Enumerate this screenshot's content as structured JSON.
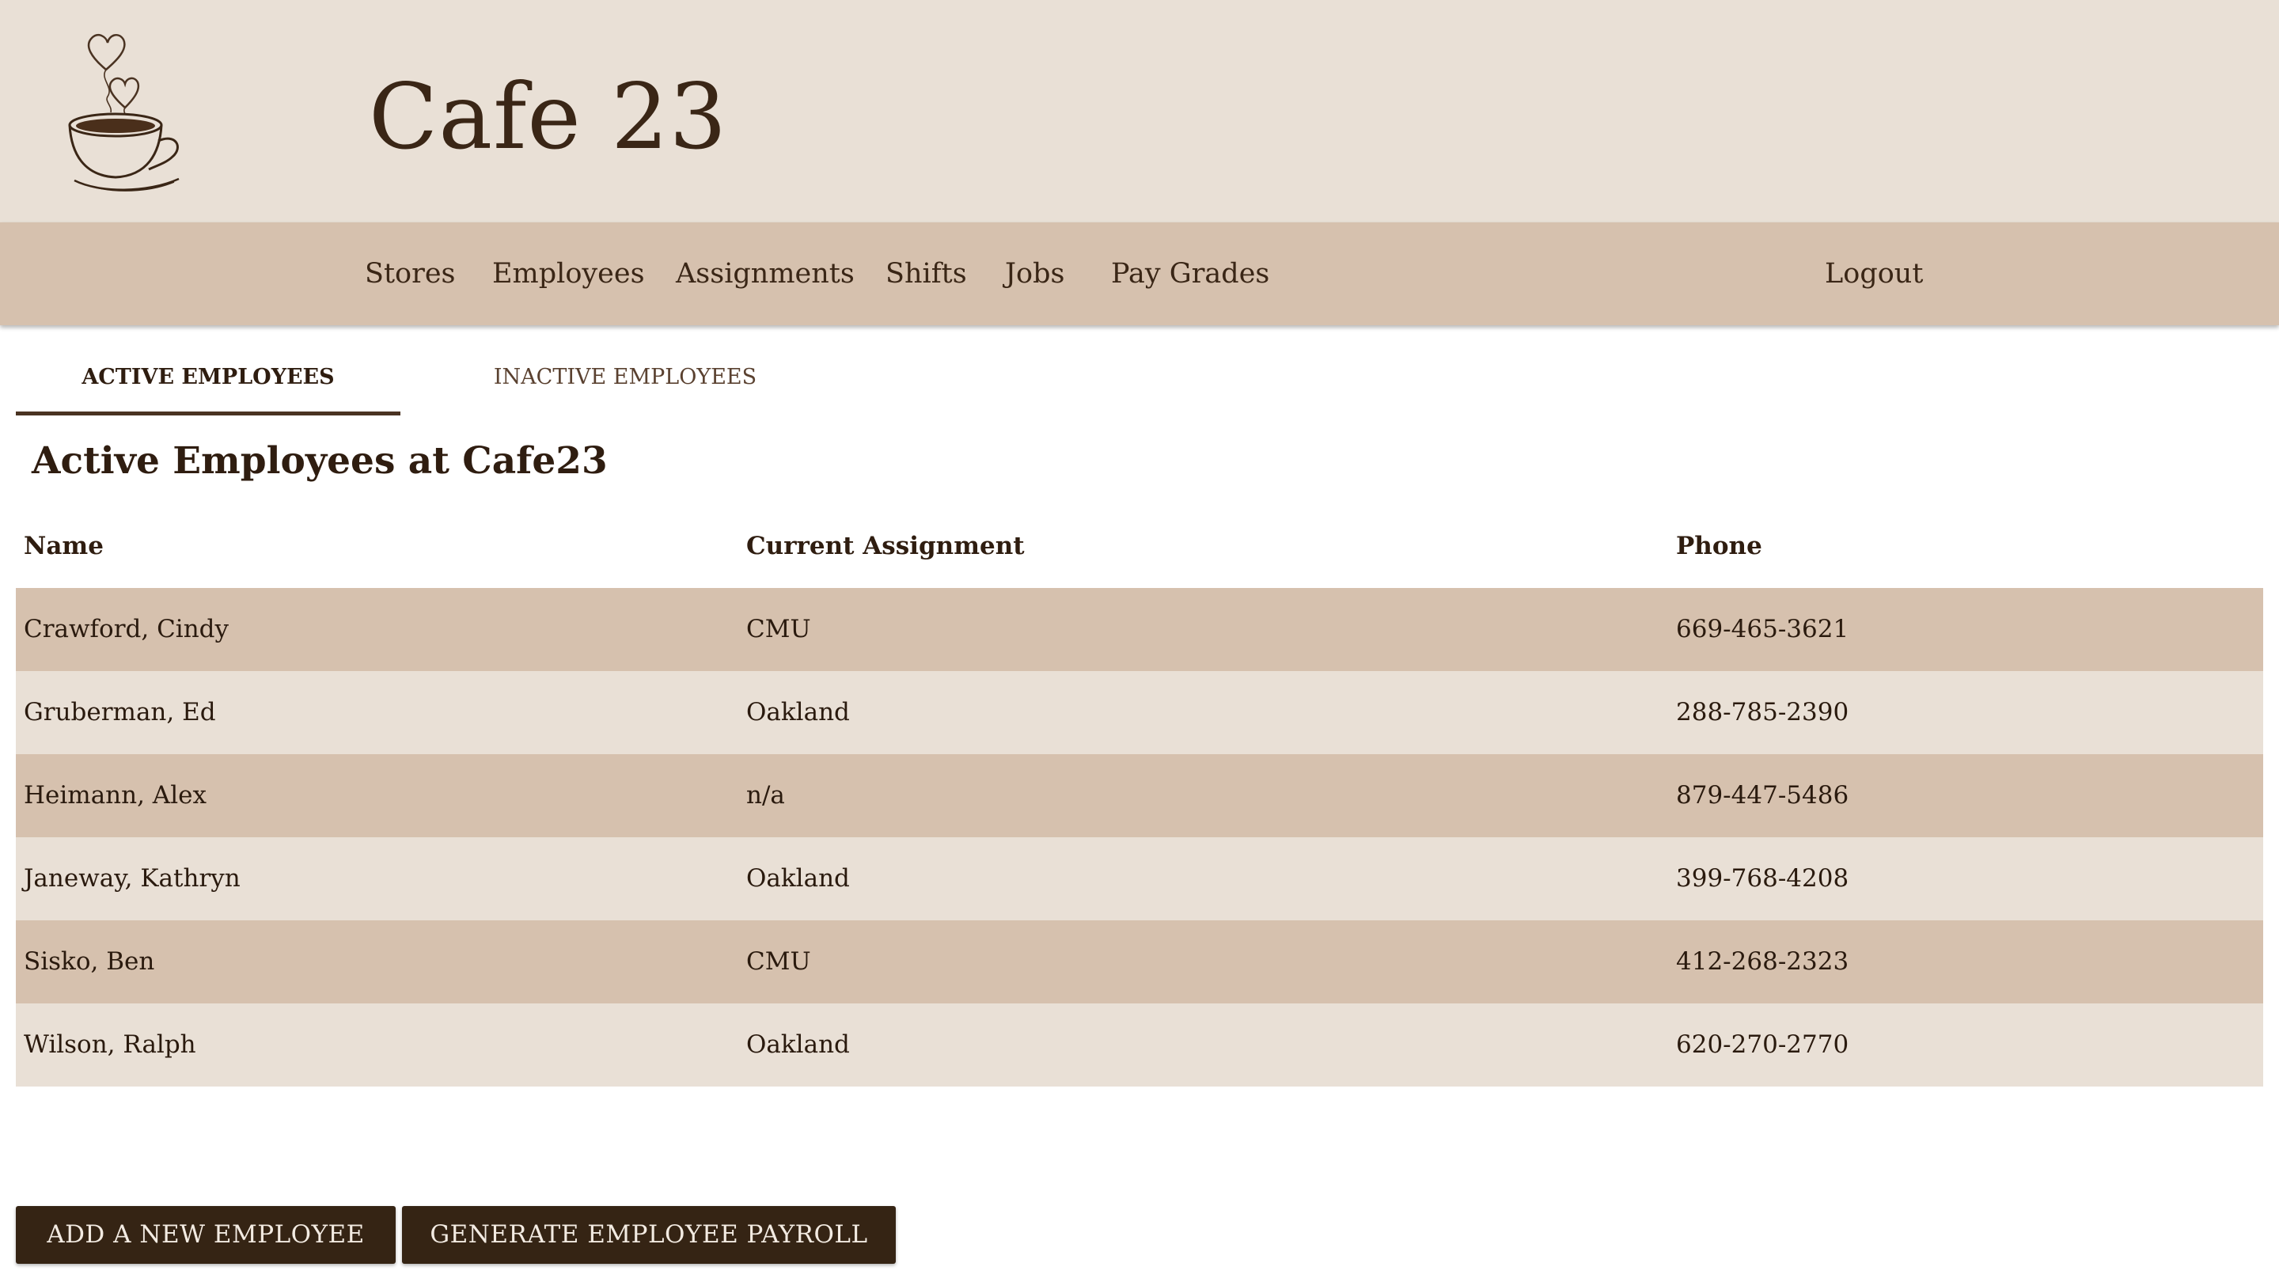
{
  "header": {
    "logo_icon": "coffee-cup-hearts-icon",
    "title": "Cafe 23"
  },
  "nav": {
    "items": [
      {
        "label": "Stores"
      },
      {
        "label": "Employees"
      },
      {
        "label": "Assignments"
      },
      {
        "label": "Shifts"
      },
      {
        "label": "Jobs"
      },
      {
        "label": "Pay Grades"
      }
    ],
    "logout_label": "Logout"
  },
  "tabs": [
    {
      "label": "ACTIVE EMPLOYEES",
      "active": true
    },
    {
      "label": "INACTIVE EMPLOYEES",
      "active": false
    }
  ],
  "section": {
    "title": "Active Employees at Cafe23"
  },
  "table": {
    "columns": [
      "Name",
      "Current Assignment",
      "Phone"
    ],
    "rows": [
      {
        "name": "Crawford, Cindy",
        "assignment": "CMU",
        "phone": "669-465-3621"
      },
      {
        "name": "Gruberman, Ed",
        "assignment": "Oakland",
        "phone": "288-785-2390"
      },
      {
        "name": "Heimann, Alex",
        "assignment": "n/a",
        "phone": "879-447-5486"
      },
      {
        "name": "Janeway, Kathryn",
        "assignment": "Oakland",
        "phone": "399-768-4208"
      },
      {
        "name": "Sisko, Ben",
        "assignment": "CMU",
        "phone": "412-268-2323"
      },
      {
        "name": "Wilson, Ralph",
        "assignment": "Oakland",
        "phone": "620-270-2770"
      }
    ]
  },
  "actions": {
    "add_label": "ADD A NEW EMPLOYEE",
    "payroll_label": "GENERATE EMPLOYEE PAYROLL"
  },
  "colors": {
    "header_bg": "#e9e0d6",
    "nav_bg": "#d6c1ae",
    "row_odd": "#d6c1ae",
    "row_even": "#e9e0d6",
    "button_bg": "#352414",
    "text_dark": "#3a2616"
  }
}
